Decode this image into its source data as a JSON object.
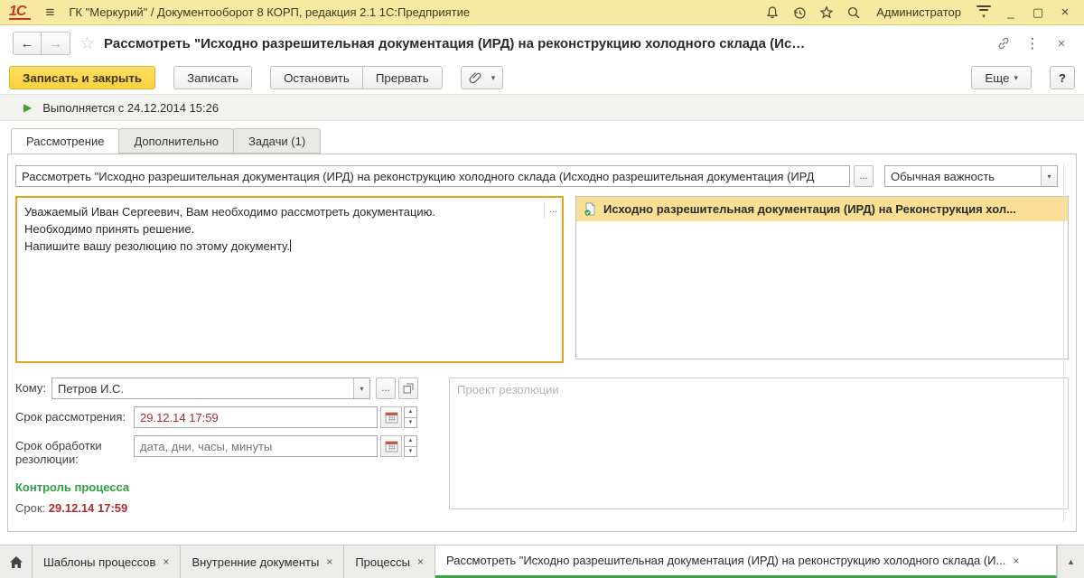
{
  "icons": {
    "hamburger": "≡",
    "minimize": "_",
    "maximize": "▢",
    "close": "×",
    "back": "←",
    "forward": "→",
    "star": "☆",
    "dots": "⋮",
    "dropdown": "▾",
    "play": "▶",
    "ellipsis": "...",
    "spin_up": "▲",
    "spin_down": "▼",
    "up_arrow": "▲",
    "logo": "1С"
  },
  "titlebar": {
    "app_title": "ГК \"Меркурий\" / Документооборот 8 КОРП, редакция 2.1 1С:Предприятие",
    "user": "Администратор"
  },
  "nav": {
    "title": "Рассмотреть \"Исходно разрешительная документация (ИРД) на реконструкцию холодного склада (Ис…"
  },
  "toolbar": {
    "save_close": "Записать и закрыть",
    "save": "Записать",
    "stop": "Остановить",
    "interrupt": "Прервать",
    "more": "Еще",
    "help": "?"
  },
  "status": {
    "text": "Выполняется с 24.12.2014 15:26"
  },
  "tabs": [
    {
      "label": "Рассмотрение"
    },
    {
      "label": "Дополнительно"
    },
    {
      "label": "Задачи (1)"
    }
  ],
  "form": {
    "subject_value": "Рассмотреть \"Исходно разрешительная документация (ИРД) на реконструкцию холодного склада (Исходно разрешительная документация (ИРД",
    "importance_value": "Обычная важность",
    "description_text": "Уважаемый Иван Сергеевич, Вам необходимо рассмотреть документацию.\nНеобходимо принять решение.\nНапишите вашу резолюцию по этому документу.",
    "attachment_label": "Исходно разрешительная документация (ИРД) на Реконструкция хол...",
    "to_label": "Кому:",
    "to_value": "Петров И.С.",
    "review_due_label": "Срок рассмотрения:",
    "review_due_value": "29.12.14 17:59",
    "resolution_due_label": "Срок обработки резолюции:",
    "resolution_due_placeholder": "дата, дни, часы, минуты",
    "control_title": "Контроль процесса",
    "control_due_label": "Срок:",
    "control_due_value": "29.12.14 17:59",
    "draft_placeholder": "Проект резолюции"
  },
  "taskbar": {
    "tabs": [
      {
        "label": "Шаблоны процессов"
      },
      {
        "label": "Внутренние документы"
      },
      {
        "label": "Процессы"
      }
    ],
    "active_label": "Рассмотреть \"Исходно разрешительная документация (ИРД) на реконструкцию холодного склада (И..."
  }
}
